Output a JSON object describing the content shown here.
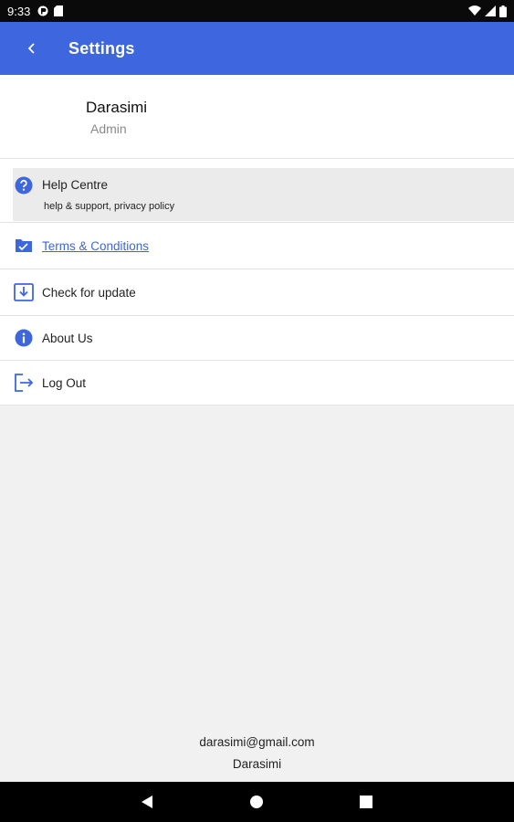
{
  "status_bar": {
    "time": "9:33"
  },
  "app_bar": {
    "title": "Settings"
  },
  "profile": {
    "name": "Darasimi",
    "role": "Admin"
  },
  "menu": {
    "items": [
      {
        "label": "Help Centre",
        "sublabel": "help & support, privacy policy",
        "icon": "help-circle-icon"
      },
      {
        "label": "Terms & Conditions",
        "icon": "folder-check-icon"
      },
      {
        "label": "Check for update",
        "icon": "download-box-icon"
      },
      {
        "label": "About Us",
        "icon": "info-circle-icon"
      },
      {
        "label": "Log Out",
        "icon": "logout-icon"
      }
    ]
  },
  "footer": {
    "email": "darasimi@gmail.com",
    "name": "Darasimi"
  },
  "colors": {
    "accent": "#3e66df",
    "background": "#f1f1f1",
    "status_bar": "#0a0a0a"
  }
}
